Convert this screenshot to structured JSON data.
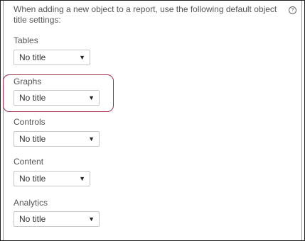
{
  "intro_text": "When adding a new object to a report, use the following default object title settings:",
  "help_icon_glyph": "?",
  "sections": [
    {
      "label": "Tables",
      "value": "No title"
    },
    {
      "label": "Graphs",
      "value": "No title"
    },
    {
      "label": "Controls",
      "value": "No title"
    },
    {
      "label": "Content",
      "value": "No title"
    },
    {
      "label": "Analytics",
      "value": "No title"
    }
  ],
  "dropdown_arrow": "▼",
  "colors": {
    "highlight_border": "#a0304a",
    "outer_border": "#1f1f1f"
  }
}
